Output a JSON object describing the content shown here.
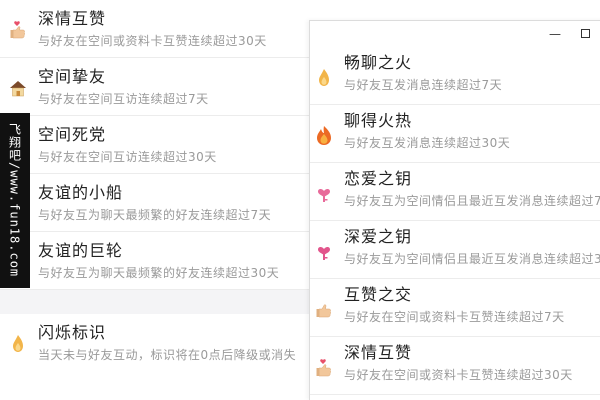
{
  "left_panel": {
    "items": [
      {
        "title": "深情互赞",
        "desc": "与好友在空间或资料卡互赞连续超过30天",
        "icon": "thumbs-up-heart-icon"
      },
      {
        "title": "空间挚友",
        "desc": "与好友在空间互访连续超过7天",
        "icon": "house-icon"
      },
      {
        "title": "空间死党",
        "desc": "与好友在空间互访连续超过30天",
        "icon": "house-icon"
      },
      {
        "title": "友谊的小船",
        "desc": "与好友互为聊天最频繁的好友连续超过7天",
        "icon": "small-boat-icon"
      },
      {
        "title": "友谊的巨轮",
        "desc": "与好友互为聊天最频繁的好友连续超过30天",
        "icon": "big-ship-icon"
      }
    ],
    "status_item": {
      "title": "闪烁标识",
      "desc": "当天未与好友互动，标识将在0点后降级或消失",
      "icon": "small-flame-icon"
    }
  },
  "watermark": {
    "text": "飞翔吧/www.fun18.com"
  },
  "right_window": {
    "window_controls": {
      "minimize": "—",
      "maximize": "□"
    },
    "items": [
      {
        "title": "畅聊之火",
        "desc": "与好友互发消息连续超过7天",
        "icon": "small-flame-icon"
      },
      {
        "title": "聊得火热",
        "desc": "与好友互发消息连续超过30天",
        "icon": "big-flame-icon"
      },
      {
        "title": "恋爱之钥",
        "desc": "与好友互为空间情侣且最近互发消息连续超过7天",
        "icon": "pink-key-icon"
      },
      {
        "title": "深爱之钥",
        "desc": "与好友互为空间情侣且最近互发消息连续超过30天",
        "icon": "pink-key-icon"
      },
      {
        "title": "互赞之交",
        "desc": "与好友在空间或资料卡互赞连续超过7天",
        "icon": "thumbs-up-icon"
      },
      {
        "title": "深情互赞",
        "desc": "与好友在空间或资料卡互赞连续超过30天",
        "icon": "thumbs-up-heart-icon"
      }
    ]
  },
  "colors": {
    "title": "#222222",
    "desc": "#9a9a9a",
    "divider": "#ececec",
    "flame": "#f0a830",
    "pink": "#e86a9a"
  }
}
